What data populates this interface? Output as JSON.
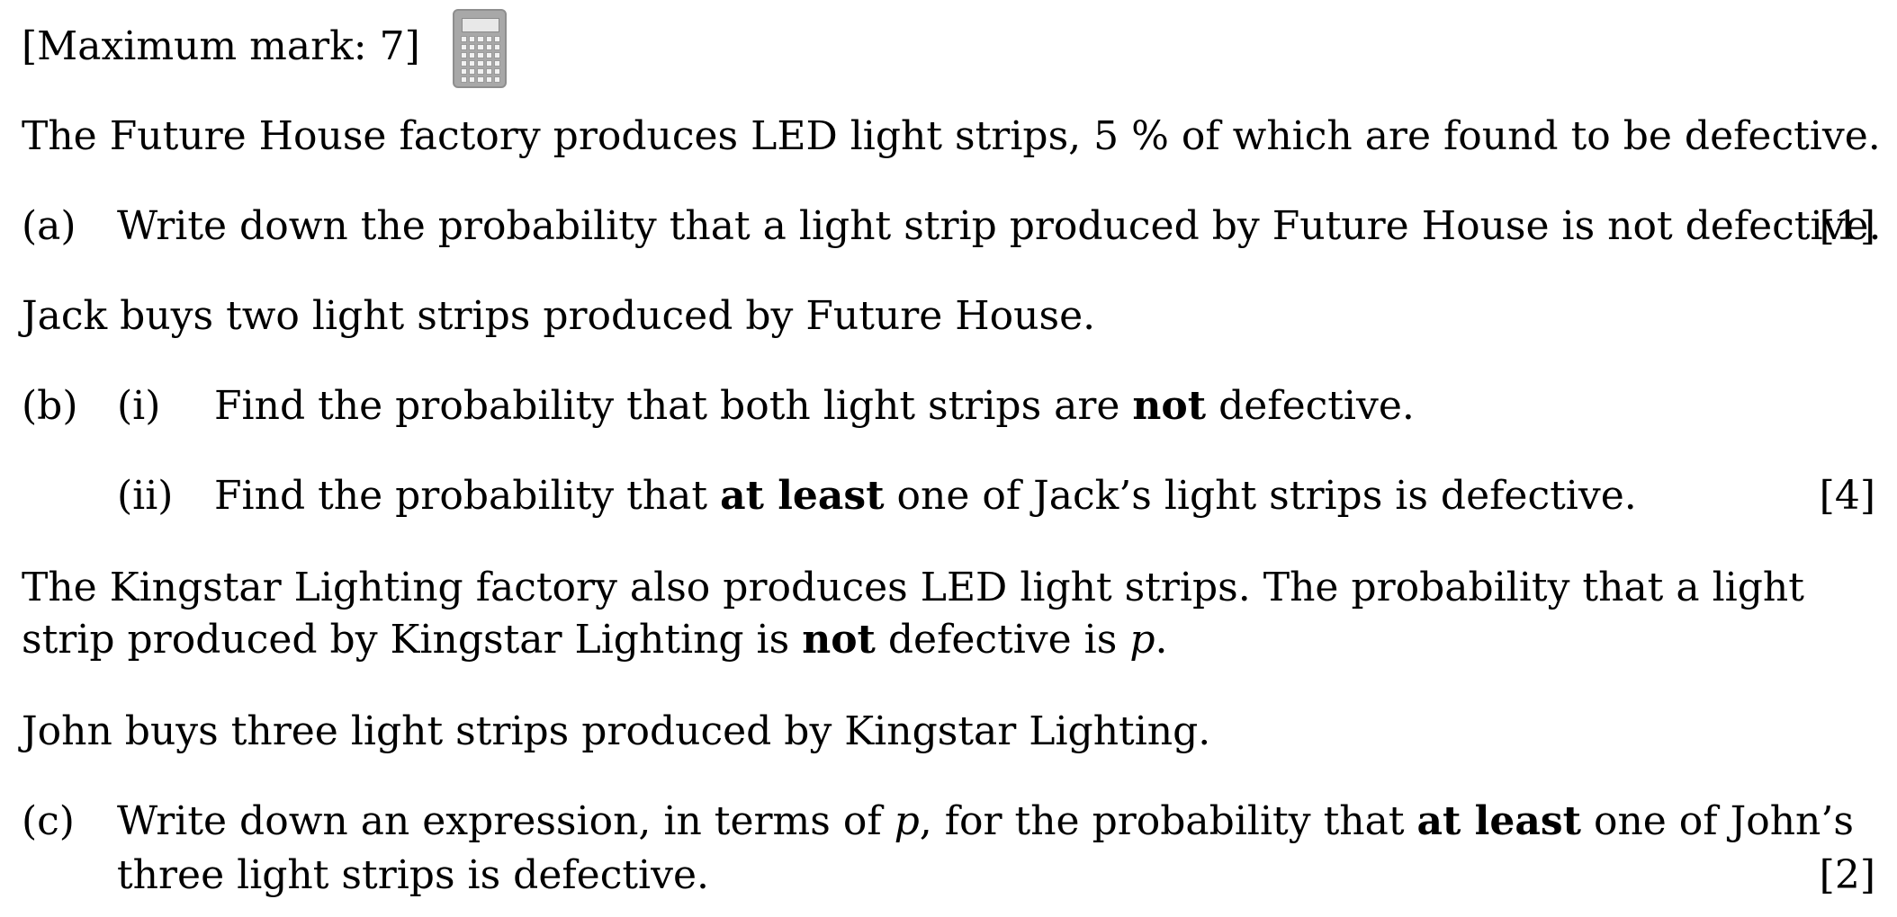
{
  "header": {
    "max_mark": "[Maximum mark:  7]",
    "calculator_icon": "calculator-icon"
  },
  "intro": {
    "text_before": "The Future House factory produces LED light strips, 5 % of which are found to be defective."
  },
  "part_a": {
    "label": "(a)",
    "text": "Write down the probability that a light strip produced by Future House is not defective.",
    "mark": "[1]"
  },
  "jack": {
    "text": "Jack buys two light strips produced by Future House."
  },
  "part_b": {
    "label": "(b)",
    "i": {
      "label": "(i)",
      "text_before": "Find the probability that both light strips are ",
      "bold": "not",
      "text_after": " defective."
    },
    "ii": {
      "label": "(ii)",
      "text_before": "Find the probability that ",
      "bold": "at least",
      "text_after": " one of Jack’s light strips is defective."
    },
    "mark": "[4]"
  },
  "kingstar": {
    "line1": "The Kingstar Lighting factory also produces LED light strips.  The probability that a light",
    "line2_before": "strip produced by Kingstar Lighting is ",
    "line2_bold": "not",
    "line2_mid": " defective is ",
    "line2_var": "p",
    "line2_end": "."
  },
  "john": {
    "text": "John buys three light strips produced by Kingstar Lighting."
  },
  "part_c": {
    "label": "(c)",
    "line1_before": "Write down an expression, in terms of ",
    "line1_var": "p",
    "line1_mid": ", for the probability that ",
    "line1_bold": "at least",
    "line1_end": " one of John’s",
    "line2": "three light strips is defective.",
    "mark": "[2]"
  }
}
